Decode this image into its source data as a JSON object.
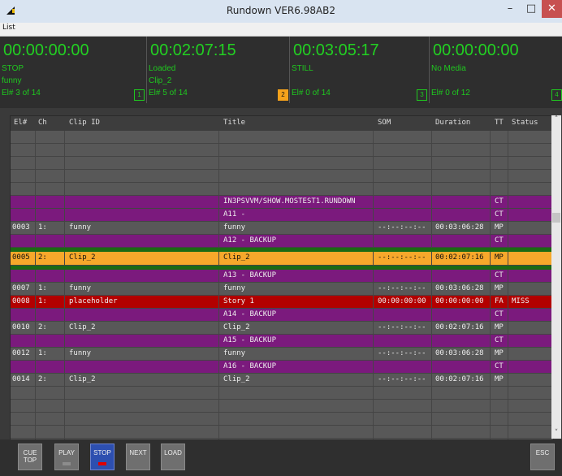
{
  "window": {
    "title": "Rundown VER6.98AB2"
  },
  "menu": {
    "items": [
      "List"
    ]
  },
  "channels": [
    {
      "time": "00:00:00:00",
      "state": "STOP",
      "clip": "funny",
      "element": "El# 3 of 14",
      "number": "1",
      "active": false
    },
    {
      "time": "00:02:07:15",
      "state": "Loaded",
      "clip": "Clip_2",
      "element": "El# 5 of 14",
      "number": "2",
      "active": true
    },
    {
      "time": "00:03:05:17",
      "state": "STILL",
      "clip": "",
      "element": "El# 0 of 14",
      "number": "3",
      "active": false
    },
    {
      "time": "00:00:00:00",
      "state": "No Media",
      "clip": "",
      "element": "El# 0 of 12",
      "number": "4",
      "active": false
    }
  ],
  "columns": [
    "El#",
    "Ch",
    "Clip ID",
    "Title",
    "SOM",
    "Duration",
    "TT",
    "Status"
  ],
  "rows": [
    {
      "style": "gray",
      "el": "",
      "ch": "",
      "clip": "",
      "title": "",
      "som": "",
      "dur": "",
      "tt": "",
      "status": ""
    },
    {
      "style": "gray",
      "el": "",
      "ch": "",
      "clip": "",
      "title": "",
      "som": "",
      "dur": "",
      "tt": "",
      "status": ""
    },
    {
      "style": "gray",
      "el": "",
      "ch": "",
      "clip": "",
      "title": "",
      "som": "",
      "dur": "",
      "tt": "",
      "status": ""
    },
    {
      "style": "gray",
      "el": "",
      "ch": "",
      "clip": "",
      "title": "",
      "som": "",
      "dur": "",
      "tt": "",
      "status": ""
    },
    {
      "style": "gray",
      "el": "",
      "ch": "",
      "clip": "",
      "title": "",
      "som": "",
      "dur": "",
      "tt": "",
      "status": ""
    },
    {
      "style": "purple",
      "el": "",
      "ch": "",
      "clip": "",
      "title": "IN3PSVVM/SHOW.MOSTEST1.RUNDOWN",
      "som": "",
      "dur": "",
      "tt": "CT",
      "status": ""
    },
    {
      "style": "purple",
      "el": "",
      "ch": "",
      "clip": "",
      "title": "A11 -",
      "som": "",
      "dur": "",
      "tt": "CT",
      "status": ""
    },
    {
      "style": "gray",
      "el": "0003",
      "ch": "1:",
      "clip": "funny",
      "title": "funny",
      "som": "--:--:--:--",
      "dur": "00:03:06:28",
      "tt": "MP",
      "status": ""
    },
    {
      "style": "purple",
      "el": "",
      "ch": "",
      "clip": "",
      "title": "A12 - BACKUP",
      "som": "",
      "dur": "",
      "tt": "CT",
      "status": ""
    },
    {
      "style": "green",
      "el": "",
      "ch": "",
      "clip": "",
      "title": "",
      "som": "",
      "dur": "",
      "tt": "",
      "status": ""
    },
    {
      "style": "orange",
      "el": "0005",
      "ch": "2:",
      "clip": "Clip_2",
      "title": "Clip_2",
      "som": "--:--:--:--",
      "dur": "00:02:07:16",
      "tt": "MP",
      "status": ""
    },
    {
      "style": "green",
      "el": "",
      "ch": "",
      "clip": "",
      "title": "",
      "som": "",
      "dur": "",
      "tt": "",
      "status": ""
    },
    {
      "style": "purple",
      "el": "",
      "ch": "",
      "clip": "",
      "title": "A13 - BACKUP",
      "som": "",
      "dur": "",
      "tt": "CT",
      "status": ""
    },
    {
      "style": "gray",
      "el": "0007",
      "ch": "1:",
      "clip": "funny",
      "title": "funny",
      "som": "--:--:--:--",
      "dur": "00:03:06:28",
      "tt": "MP",
      "status": ""
    },
    {
      "style": "red",
      "el": "0008",
      "ch": "1:",
      "clip": "placeholder",
      "title": "Story 1",
      "som": "00:00:00:00",
      "dur": "00:00:00:00",
      "tt": "FA",
      "status": "MISS"
    },
    {
      "style": "purple",
      "el": "",
      "ch": "",
      "clip": "",
      "title": "A14 - BACKUP",
      "som": "",
      "dur": "",
      "tt": "CT",
      "status": ""
    },
    {
      "style": "gray",
      "el": "0010",
      "ch": "2:",
      "clip": "Clip_2",
      "title": "Clip_2",
      "som": "--:--:--:--",
      "dur": "00:02:07:16",
      "tt": "MP",
      "status": ""
    },
    {
      "style": "purple",
      "el": "",
      "ch": "",
      "clip": "",
      "title": "A15 - BACKUP",
      "som": "",
      "dur": "",
      "tt": "CT",
      "status": ""
    },
    {
      "style": "gray",
      "el": "0012",
      "ch": "1:",
      "clip": "funny",
      "title": "funny",
      "som": "--:--:--:--",
      "dur": "00:03:06:28",
      "tt": "MP",
      "status": ""
    },
    {
      "style": "purple",
      "el": "",
      "ch": "",
      "clip": "",
      "title": "A16 - BACKUP",
      "som": "",
      "dur": "",
      "tt": "CT",
      "status": ""
    },
    {
      "style": "gray",
      "el": "0014",
      "ch": "2:",
      "clip": "Clip_2",
      "title": "Clip_2",
      "som": "--:--:--:--",
      "dur": "00:02:07:16",
      "tt": "MP",
      "status": ""
    },
    {
      "style": "gray",
      "el": "",
      "ch": "",
      "clip": "",
      "title": "",
      "som": "",
      "dur": "",
      "tt": "",
      "status": ""
    },
    {
      "style": "gray",
      "el": "",
      "ch": "",
      "clip": "",
      "title": "",
      "som": "",
      "dur": "",
      "tt": "",
      "status": ""
    },
    {
      "style": "gray",
      "el": "",
      "ch": "",
      "clip": "",
      "title": "",
      "som": "",
      "dur": "",
      "tt": "",
      "status": ""
    },
    {
      "style": "gray",
      "el": "",
      "ch": "",
      "clip": "",
      "title": "",
      "som": "",
      "dur": "",
      "tt": "",
      "status": ""
    },
    {
      "style": "gray",
      "el": "",
      "ch": "",
      "clip": "",
      "title": "",
      "som": "",
      "dur": "",
      "tt": "",
      "status": ""
    }
  ],
  "buttons": {
    "cue_top": "CUE TOP",
    "play": "PLAY",
    "stop": "STOP",
    "next": "NEXT",
    "load": "LOAD",
    "esc": "ESC"
  },
  "colors": {
    "timecode_green": "#22d022",
    "active_row": "#f7a82b",
    "marker_row": "#7b1a7d",
    "error_row": "#b30000",
    "green_bar": "#1c6a13",
    "stop_button": "#2d4fb0"
  }
}
